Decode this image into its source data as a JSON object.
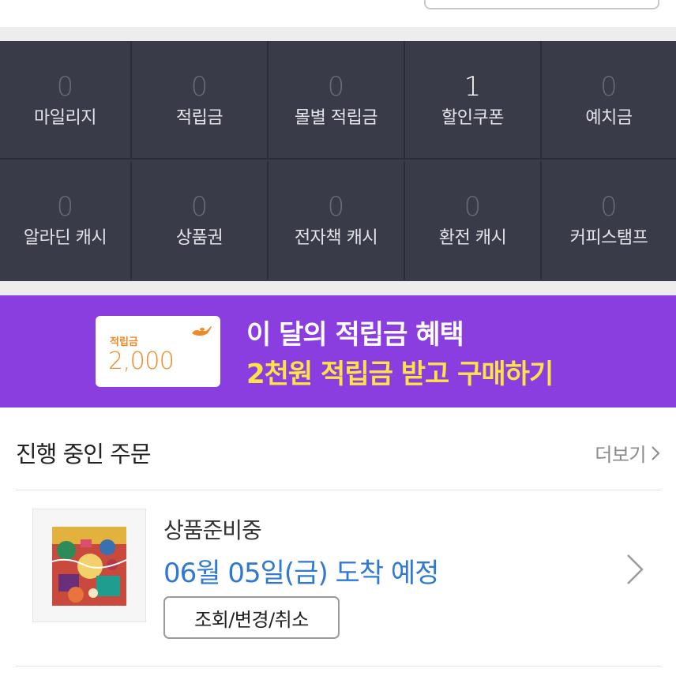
{
  "wallet": {
    "items": [
      {
        "value": "0",
        "label": "마일리지"
      },
      {
        "value": "0",
        "label": "적립금"
      },
      {
        "value": "0",
        "label": "몰별 적립금"
      },
      {
        "value": "1",
        "label": "할인쿠폰"
      },
      {
        "value": "0",
        "label": "예치금"
      },
      {
        "value": "0",
        "label": "알라딘 캐시"
      },
      {
        "value": "0",
        "label": "상품권"
      },
      {
        "value": "0",
        "label": "전자책 캐시"
      },
      {
        "value": "0",
        "label": "환전 캐시"
      },
      {
        "value": "0",
        "label": "커피스탬프"
      }
    ]
  },
  "banner": {
    "card_label": "적립금",
    "card_amount": "2,000",
    "line1": "이 달의 적립금 혜택",
    "line2": "2천원 적립금 받고 구매하기"
  },
  "orders": {
    "title": "진행 중인 주문",
    "more_label": "더보기",
    "item": {
      "status": "상품준비중",
      "eta": "06월 05일(금) 도착 예정",
      "button_label": "조회/변경/취소"
    }
  },
  "colors": {
    "wallet_bg": "#3a3b48",
    "banner_bg": "#8b3ee0",
    "banner_highlight": "#ffe245",
    "eta_blue": "#2f79d4",
    "coupon_orange": "#f08a28"
  }
}
